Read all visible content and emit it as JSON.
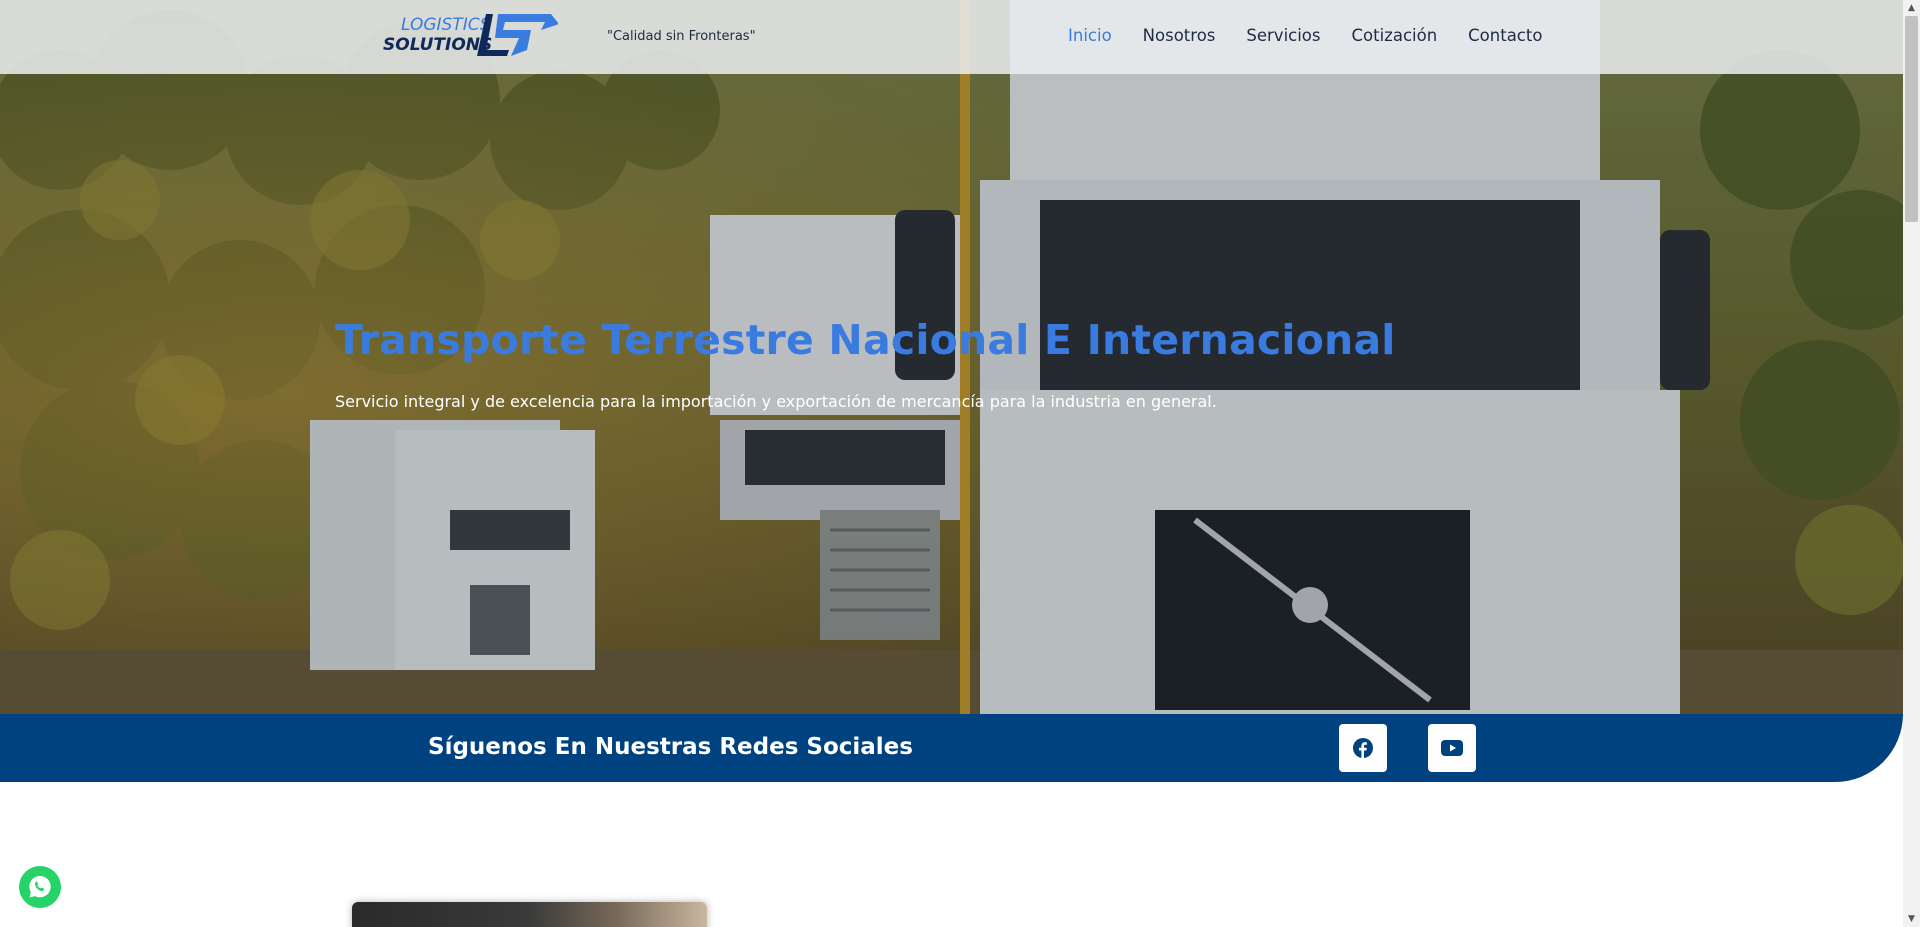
{
  "header": {
    "logo_alt": "Logistics Solutions",
    "logo_line1": "LOGISTICS",
    "logo_line2": "SOLUTIONS",
    "tagline": "\"Calidad sin Fronteras\"",
    "nav": [
      {
        "label": "Inicio",
        "active": true
      },
      {
        "label": "Nosotros",
        "active": false
      },
      {
        "label": "Servicios",
        "active": false
      },
      {
        "label": "Cotización",
        "active": false
      },
      {
        "label": "Contacto",
        "active": false
      }
    ]
  },
  "hero": {
    "title": "Transporte Terrestre Nacional E Internacional",
    "subtitle": "Servicio integral y de excelencia para la importación y exportación de mercancía para la industria en general.",
    "background": "trucks-on-highway-forest"
  },
  "social": {
    "title": "Síguenos En Nuestras Redes Sociales",
    "buttons": [
      {
        "icon": "facebook-icon"
      },
      {
        "icon": "youtube-icon"
      }
    ]
  },
  "floating": {
    "whatsapp_icon": "whatsapp-icon"
  },
  "colors": {
    "accent": "#3a7be0",
    "brand_dark": "#004280",
    "nav_text": "#1f2a44",
    "whatsapp": "#25d366"
  }
}
